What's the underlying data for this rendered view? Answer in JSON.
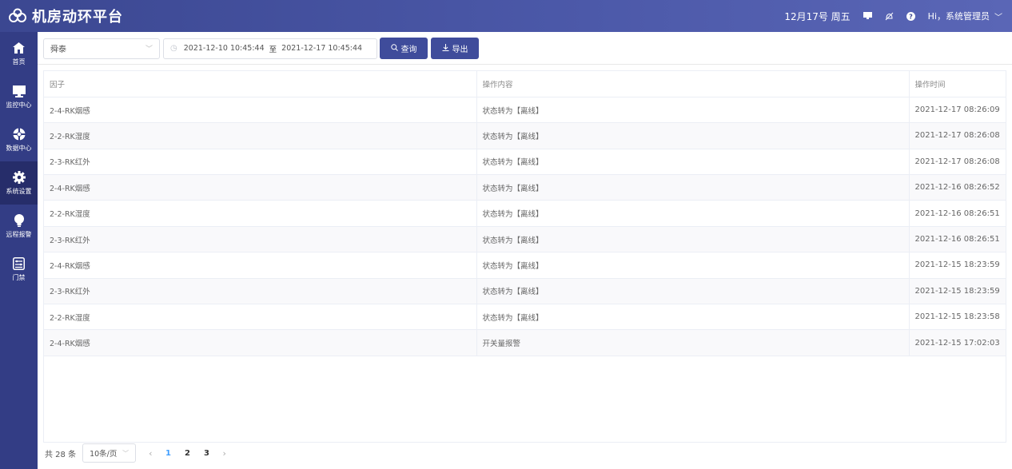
{
  "header": {
    "title": "机房动环平台",
    "date": "12月17号 周五",
    "user": "Hi，系统管理员",
    "icons": [
      "monitor-icon",
      "bell-off-icon",
      "help-icon"
    ]
  },
  "sidebar": {
    "items": [
      {
        "label": "首页",
        "icon": "home-icon"
      },
      {
        "label": "监控中心",
        "icon": "monitor-icon"
      },
      {
        "label": "数据中心",
        "icon": "data-icon"
      },
      {
        "label": "系统设置",
        "icon": "gear-icon",
        "active": true
      },
      {
        "label": "远程报警",
        "icon": "bulb-icon"
      },
      {
        "label": "门禁",
        "icon": "door-icon"
      }
    ]
  },
  "filters": {
    "room": "舜泰",
    "start": "2021-12-10 10:45:44",
    "sep": "至",
    "end": "2021-12-17 10:45:44",
    "search_label": "查询",
    "export_label": "导出"
  },
  "table": {
    "headers": [
      "因子",
      "操作内容",
      "操作时间"
    ],
    "rows": [
      [
        "2-4-RK烟感",
        "状态转为【离线】",
        "2021-12-17 08:26:09"
      ],
      [
        "2-2-RK湿度",
        "状态转为【离线】",
        "2021-12-17 08:26:08"
      ],
      [
        "2-3-RK红外",
        "状态转为【离线】",
        "2021-12-17 08:26:08"
      ],
      [
        "2-4-RK烟感",
        "状态转为【离线】",
        "2021-12-16 08:26:52"
      ],
      [
        "2-2-RK湿度",
        "状态转为【离线】",
        "2021-12-16 08:26:51"
      ],
      [
        "2-3-RK红外",
        "状态转为【离线】",
        "2021-12-16 08:26:51"
      ],
      [
        "2-4-RK烟感",
        "状态转为【离线】",
        "2021-12-15 18:23:59"
      ],
      [
        "2-3-RK红外",
        "状态转为【离线】",
        "2021-12-15 18:23:59"
      ],
      [
        "2-2-RK湿度",
        "状态转为【离线】",
        "2021-12-15 18:23:58"
      ],
      [
        "2-4-RK烟感",
        "开关量报警",
        "2021-12-15 17:02:03"
      ]
    ]
  },
  "pagination": {
    "total": "共 28 条",
    "page_size": "10条/页",
    "pages": [
      "1",
      "2",
      "3"
    ],
    "current": "1"
  },
  "colors": {
    "header": "#3b4791",
    "sidebar": "#333d85",
    "sidebar_active": "#262d6a",
    "button": "#3f4c9b",
    "page_active": "#409eff"
  }
}
